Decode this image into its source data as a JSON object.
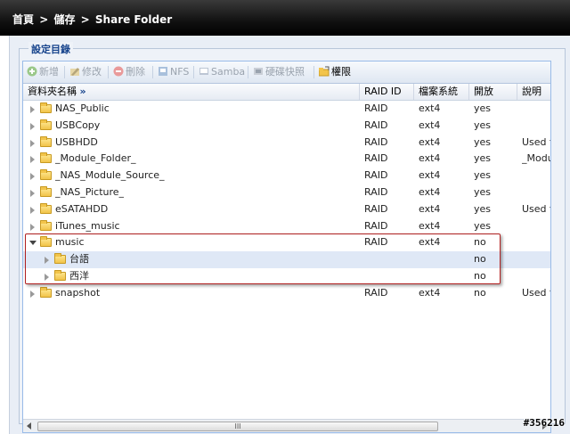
{
  "breadcrumb": [
    "首頁",
    ">",
    "儲存",
    ">",
    "Share Folder"
  ],
  "fieldset_title": "設定目錄",
  "toolbar": {
    "add": "新增",
    "edit": "修改",
    "delete": "刪除",
    "nfs": "NFS",
    "samba": "Samba",
    "snapshot": "硬碟快照",
    "permission": "權限"
  },
  "columns": {
    "name": "資料夾名稱",
    "raid": "RAID ID",
    "fs": "檔案系統",
    "open": "開放",
    "desc": "說明"
  },
  "rows": [
    {
      "name": "NAS_Public",
      "raid": "RAID",
      "fs": "ext4",
      "open": "yes",
      "desc": ""
    },
    {
      "name": "USBCopy",
      "raid": "RAID",
      "fs": "ext4",
      "open": "yes",
      "desc": ""
    },
    {
      "name": "USBHDD",
      "raid": "RAID",
      "fs": "ext4",
      "open": "yes",
      "desc": "Used for ext"
    },
    {
      "name": "_Module_Folder_",
      "raid": "RAID",
      "fs": "ext4",
      "open": "yes",
      "desc": "_Module_Fo"
    },
    {
      "name": "_NAS_Module_Source_",
      "raid": "RAID",
      "fs": "ext4",
      "open": "yes",
      "desc": ""
    },
    {
      "name": "_NAS_Picture_",
      "raid": "RAID",
      "fs": "ext4",
      "open": "yes",
      "desc": ""
    },
    {
      "name": "eSATAHDD",
      "raid": "RAID",
      "fs": "ext4",
      "open": "yes",
      "desc": "Used for eS"
    },
    {
      "name": "iTunes_music",
      "raid": "RAID",
      "fs": "ext4",
      "open": "yes",
      "desc": ""
    },
    {
      "name": "music",
      "raid": "RAID",
      "fs": "ext4",
      "open": "no",
      "desc": ""
    },
    {
      "name": "台語",
      "raid": "",
      "fs": "",
      "open": "no",
      "desc": ""
    },
    {
      "name": "西洋",
      "raid": "",
      "fs": "",
      "open": "no",
      "desc": ""
    },
    {
      "name": "snapshot",
      "raid": "RAID",
      "fs": "ext4",
      "open": "no",
      "desc": "Used for sn"
    }
  ],
  "scroll_grip": "III",
  "watermark": "#356216",
  "colors": {
    "titlebar": "#111111",
    "highlight_border": "#b02020",
    "selected_row": "#dfe8f6"
  }
}
